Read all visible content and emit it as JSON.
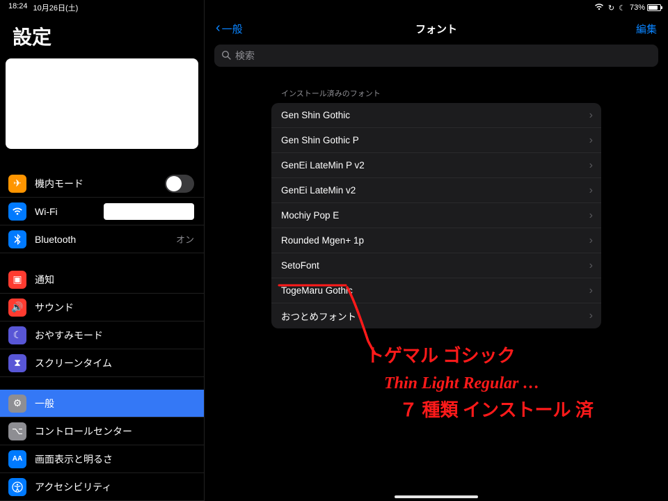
{
  "status": {
    "time": "18:24",
    "date": "10月26日(土)",
    "battery_pct": "73%"
  },
  "sidebar": {
    "title": "設定",
    "items": {
      "airplane": "機内モード",
      "wifi": "Wi-Fi",
      "bt": "Bluetooth",
      "bt_val": "オン",
      "notif": "通知",
      "sound": "サウンド",
      "dnd": "おやすみモード",
      "screentime": "スクリーンタイム",
      "general": "一般",
      "cc": "コントロールセンター",
      "display": "画面表示と明るさ",
      "access": "アクセシビリティ"
    }
  },
  "detail": {
    "back": "一般",
    "title": "フォント",
    "edit": "編集",
    "search_placeholder": "検索",
    "section_header": "インストール済みのフォント",
    "fonts": [
      "Gen Shin Gothic",
      "Gen Shin Gothic P",
      "GenEi LateMin P v2",
      "GenEi LateMin v2",
      "Mochiy Pop E",
      "Rounded Mgen+ 1p",
      "SetoFont",
      "TogeMaru Gothic",
      "おつとめフォント"
    ]
  },
  "annotation": {
    "line1": "トゲマル ゴシック",
    "line2": "Thin  Light  Regular …",
    "line3": "７ 種類  インストール 済"
  }
}
